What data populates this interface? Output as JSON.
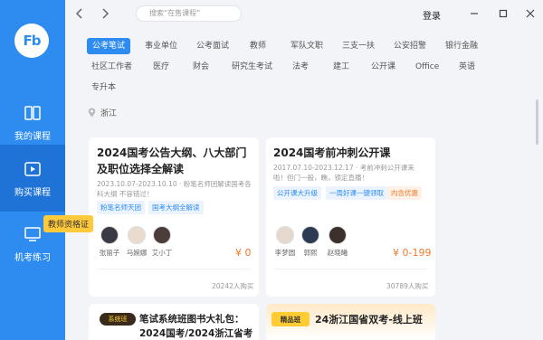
{
  "app": {
    "logo_text": "Fb"
  },
  "sidebar": {
    "items": [
      {
        "label": "我的课程",
        "icon": "book-icon"
      },
      {
        "label": "购买课程",
        "icon": "play-icon"
      },
      {
        "label": "机考练习",
        "icon": "computer-icon"
      }
    ],
    "tooltip": "教师资格证"
  },
  "topbar": {
    "search_placeholder": "搜索“在售课程”",
    "login_label": "登录"
  },
  "categories": [
    "公考笔试",
    "事业单位",
    "公考面试",
    "教师",
    "军队文职",
    "三支一扶",
    "公安招警",
    "银行金融",
    "社区工作者",
    "医疗",
    "财会",
    "研究生考试",
    "法考",
    "建工",
    "公开课",
    "Office",
    "英语",
    "专升本"
  ],
  "location": "浙江",
  "cards": [
    {
      "title": "2024国考公告大纲、八大部门及职位选择全解读",
      "meta": "2023.10.07-2023.10.10 · 粉笔名师团解读国考各科大纲 不容错过！",
      "tags": [
        "粉笔名师天团",
        "国考大纲全解读"
      ],
      "teachers": [
        "张丽子",
        "马婉娜",
        "艾小丁"
      ],
      "price": "¥ 0",
      "buyers": "20242人购买"
    },
    {
      "title": "2024国考前冲刺公开课",
      "meta": "2017.07.10-2023.12.17 · 考前冲刺公开课来啦！但门一般，瞧，锁定直播！",
      "tags": [
        "公开课大升级",
        "一周好课一键领取",
        "内含优惠"
      ],
      "teachers": [
        "李梦圆",
        "郭熙",
        "赵晓曦"
      ],
      "price": "¥ 0-199",
      "buyers": "30789人购买"
    },
    {
      "badge": "系统班",
      "title": "笔试系统班图书大礼包：2024国考/2024浙江省考"
    },
    {
      "badge": "精品班",
      "title": "24浙江国省双考-线上班"
    }
  ]
}
